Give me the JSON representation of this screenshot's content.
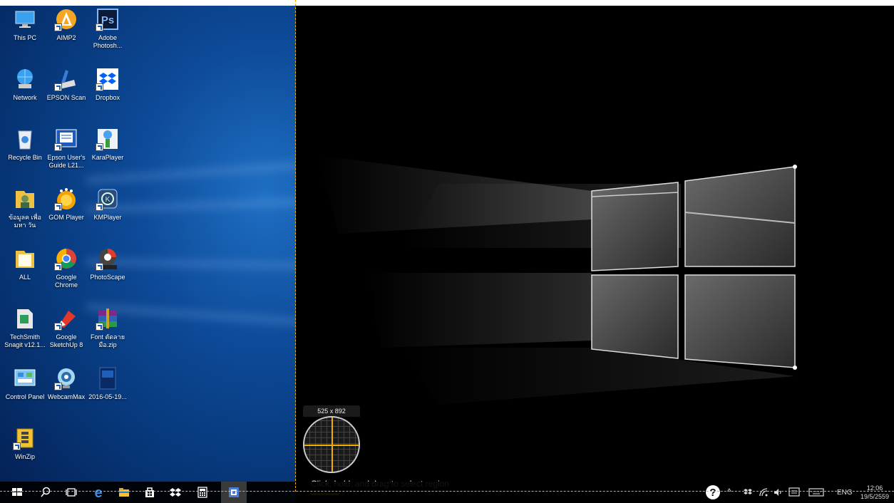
{
  "desktop_icons": [
    {
      "id": "this-pc",
      "label": "This PC"
    },
    {
      "id": "aimp2",
      "label": "AIMP2"
    },
    {
      "id": "photoshop",
      "label": "Adobe Photosh..."
    },
    {
      "id": "network",
      "label": "Network"
    },
    {
      "id": "epson-scan",
      "label": "EPSON Scan"
    },
    {
      "id": "dropbox",
      "label": "Dropbox"
    },
    {
      "id": "recycle-bin",
      "label": "Recycle Bin"
    },
    {
      "id": "epson-guide",
      "label": "Epson User's Guide L21..."
    },
    {
      "id": "karaplayer",
      "label": "KaraPlayer"
    },
    {
      "id": "user-folder",
      "label": "ข้อมูลค เพื่อมหา วัน"
    },
    {
      "id": "gom-player",
      "label": "GOM Player"
    },
    {
      "id": "kmplayer",
      "label": "KMPlayer"
    },
    {
      "id": "all-folder",
      "label": "ALL"
    },
    {
      "id": "chrome",
      "label": "Google Chrome"
    },
    {
      "id": "photoscape",
      "label": "PhotoScape"
    },
    {
      "id": "snagit",
      "label": "TechSmith Snagit v12.1..."
    },
    {
      "id": "sketchup",
      "label": "Google SketchUp 8"
    },
    {
      "id": "font-zip",
      "label": "Font ตัดลาย มือ.zip"
    },
    {
      "id": "control-panel",
      "label": "Control Panel"
    },
    {
      "id": "webcammax",
      "label": "WebcamMax"
    },
    {
      "id": "screenshot-file",
      "label": "2016-05-19..."
    },
    {
      "id": "winzip",
      "label": "WinZip"
    }
  ],
  "magnifier": {
    "dimensions": "525 x 892"
  },
  "capture_hint": "Click, hold, and drag to select region",
  "tray": {
    "language": "ENG",
    "time": "12:06",
    "date": "19/5/2559"
  },
  "colors": {
    "accent": "#f0b000",
    "taskbar": "#000000",
    "desktop_blue": "#0d4a98"
  }
}
